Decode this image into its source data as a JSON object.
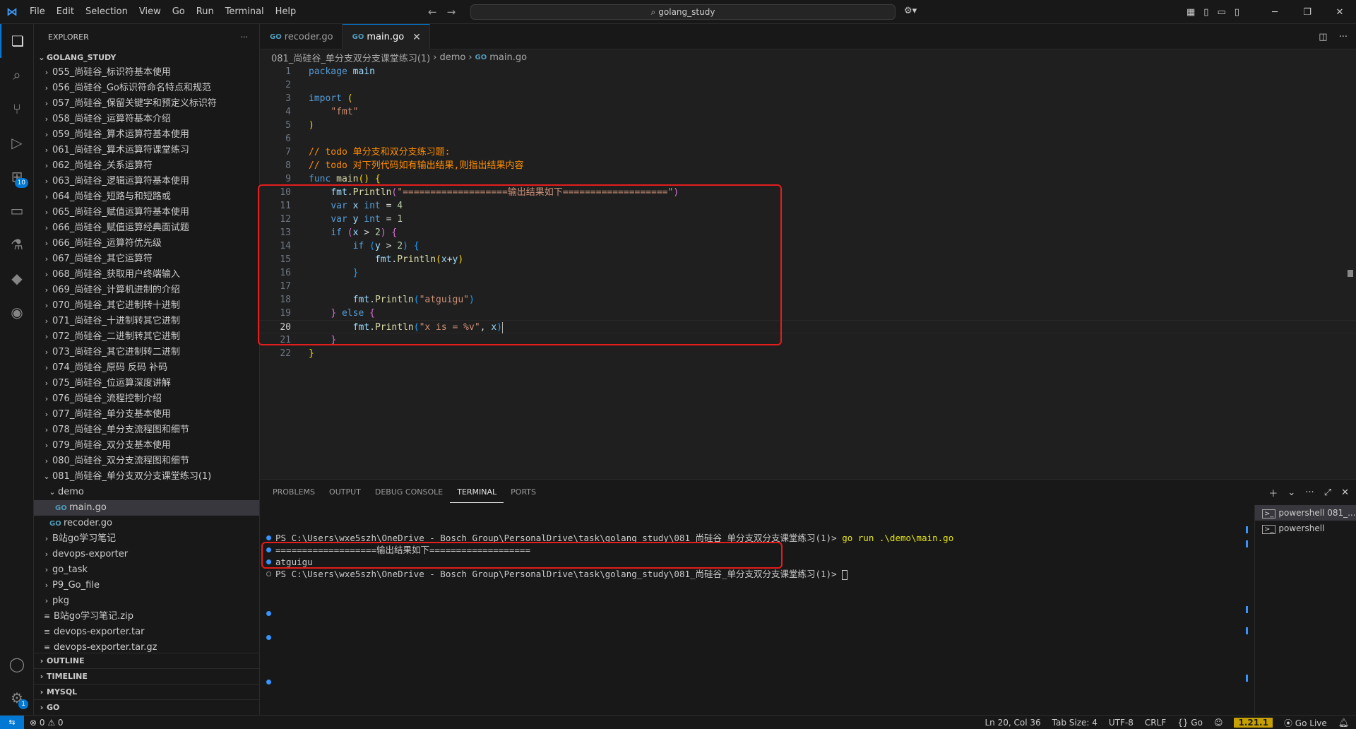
{
  "titlebar": {
    "menu": [
      "File",
      "Edit",
      "Selection",
      "View",
      "Go",
      "Run",
      "Terminal",
      "Help"
    ],
    "search": "golang_study"
  },
  "activity": {
    "extensions_badge": "10",
    "settings_badge": "1"
  },
  "sidebar": {
    "title": "EXPLORER",
    "root": "GOLANG_STUDY",
    "items": [
      {
        "label": "055_尚硅谷_标识符基本使用",
        "type": "folder",
        "depth": 1
      },
      {
        "label": "056_尚硅谷_Go标识符命名特点和规范",
        "type": "folder",
        "depth": 1
      },
      {
        "label": "057_尚硅谷_保留关键字和预定义标识符",
        "type": "folder",
        "depth": 1
      },
      {
        "label": "058_尚硅谷_运算符基本介绍",
        "type": "folder",
        "depth": 1
      },
      {
        "label": "059_尚硅谷_算术运算符基本使用",
        "type": "folder",
        "depth": 1
      },
      {
        "label": "061_尚硅谷_算术运算符课堂练习",
        "type": "folder",
        "depth": 1
      },
      {
        "label": "062_尚硅谷_关系运算符",
        "type": "folder",
        "depth": 1
      },
      {
        "label": "063_尚硅谷_逻辑运算符基本使用",
        "type": "folder",
        "depth": 1
      },
      {
        "label": "064_尚硅谷_短路与和短路或",
        "type": "folder",
        "depth": 1
      },
      {
        "label": "065_尚硅谷_赋值运算符基本使用",
        "type": "folder",
        "depth": 1
      },
      {
        "label": "066_尚硅谷_赋值运算经典面试题",
        "type": "folder",
        "depth": 1
      },
      {
        "label": "066_尚硅谷_运算符优先级",
        "type": "folder",
        "depth": 1
      },
      {
        "label": "067_尚硅谷_其它运算符",
        "type": "folder",
        "depth": 1
      },
      {
        "label": "068_尚硅谷_获取用户终端输入",
        "type": "folder",
        "depth": 1
      },
      {
        "label": "069_尚硅谷_计算机进制的介绍",
        "type": "folder",
        "depth": 1
      },
      {
        "label": "070_尚硅谷_其它进制转十进制",
        "type": "folder",
        "depth": 1
      },
      {
        "label": "071_尚硅谷_十进制转其它进制",
        "type": "folder",
        "depth": 1
      },
      {
        "label": "072_尚硅谷_二进制转其它进制",
        "type": "folder",
        "depth": 1
      },
      {
        "label": "073_尚硅谷_其它进制转二进制",
        "type": "folder",
        "depth": 1
      },
      {
        "label": "074_尚硅谷_原码 反码 补码",
        "type": "folder",
        "depth": 1
      },
      {
        "label": "075_尚硅谷_位运算深度讲解",
        "type": "folder",
        "depth": 1
      },
      {
        "label": "076_尚硅谷_流程控制介绍",
        "type": "folder",
        "depth": 1
      },
      {
        "label": "077_尚硅谷_单分支基本使用",
        "type": "folder",
        "depth": 1
      },
      {
        "label": "078_尚硅谷_单分支流程图和细节",
        "type": "folder",
        "depth": 1
      },
      {
        "label": "079_尚硅谷_双分支基本使用",
        "type": "folder",
        "depth": 1
      },
      {
        "label": "080_尚硅谷_双分支流程图和细节",
        "type": "folder",
        "depth": 1
      },
      {
        "label": "081_尚硅谷_单分支双分支课堂练习(1)",
        "type": "folder-open",
        "depth": 1
      },
      {
        "label": "demo",
        "type": "folder-open",
        "depth": 2
      },
      {
        "label": "main.go",
        "type": "go",
        "depth": 3,
        "selected": true
      },
      {
        "label": "recoder.go",
        "type": "go",
        "depth": 2
      },
      {
        "label": "B站go学习笔记",
        "type": "folder",
        "depth": 1
      },
      {
        "label": "devops-exporter",
        "type": "folder",
        "depth": 1
      },
      {
        "label": "go_task",
        "type": "folder",
        "depth": 1
      },
      {
        "label": "P9_Go_file",
        "type": "folder",
        "depth": 1
      },
      {
        "label": "pkg",
        "type": "folder",
        "depth": 1
      },
      {
        "label": "B站go学习笔记.zip",
        "type": "file",
        "depth": 1
      },
      {
        "label": "devops-exporter.tar",
        "type": "file",
        "depth": 1
      },
      {
        "label": "devops-exporter.tar.gz",
        "type": "file",
        "depth": 1
      }
    ],
    "sections": [
      "OUTLINE",
      "TIMELINE",
      "MYSQL",
      "GO"
    ]
  },
  "editor": {
    "tabs": [
      {
        "label": "recoder.go",
        "active": false
      },
      {
        "label": "main.go",
        "active": true
      }
    ],
    "breadcrumb": [
      "081_尚硅谷_单分支双分支课堂练习(1)",
      "demo",
      "main.go"
    ],
    "current_line": 20
  },
  "panel": {
    "tabs": [
      "PROBLEMS",
      "OUTPUT",
      "DEBUG CONSOLE",
      "TERMINAL",
      "PORTS"
    ],
    "active_tab": "TERMINAL",
    "terminal_lines": [
      {
        "prompt": "PS C:\\Users\\wxe5szh\\OneDrive - Bosch Group\\PersonalDrive\\task\\golang_study\\081_尚硅谷_单分支双分支课堂练习(1)> ",
        "cmd": "go run .\\demo\\main.go"
      },
      {
        "text": "===================输出结果如下==================="
      },
      {
        "text": "atguigu"
      },
      {
        "prompt": "PS C:\\Users\\wxe5szh\\OneDrive - Bosch Group\\PersonalDrive\\task\\golang_study\\081_尚硅谷_单分支双分支课堂练习(1)> ",
        "cmd": ""
      }
    ],
    "terminals": [
      "powershell 081_...",
      "powershell"
    ]
  },
  "statusbar": {
    "problems": "⊗ 0 ⚠ 0",
    "position": "Ln 20, Col 36",
    "tabsize": "Tab Size: 4",
    "encoding": "UTF-8",
    "eol": "CRLF",
    "language": "{} Go",
    "go_version": "1.21.1",
    "golive": "Go Live"
  }
}
